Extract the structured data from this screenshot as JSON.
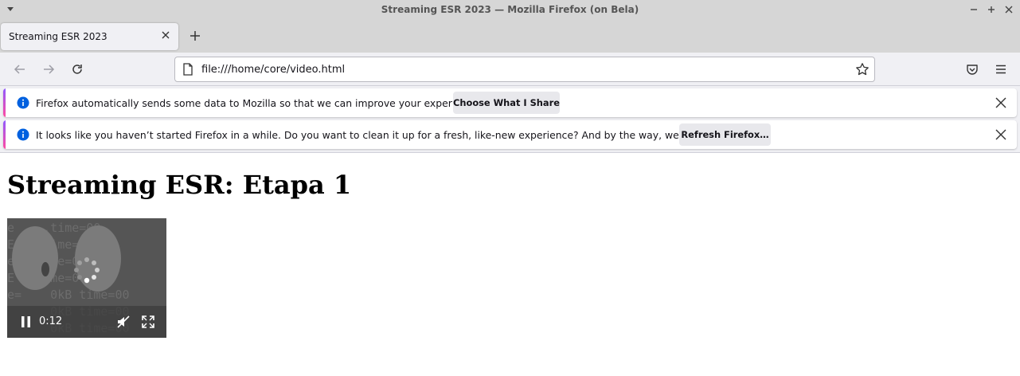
{
  "window": {
    "title": "Streaming ESR 2023 — Mozilla Firefox (on Bela)"
  },
  "tabs": [
    {
      "label": "Streaming ESR 2023"
    }
  ],
  "navbar": {
    "url": "file:///home/core/video.html"
  },
  "notifications": [
    {
      "message": "Firefox automatically sends some data to Mozilla so that we can improve your experience.",
      "button_label": "Choose What I Share"
    },
    {
      "message": "It looks like you haven’t started Firefox in a while. Do you want to clean it up for a fresh, like-new experience? And by the way, welcome back!",
      "button_label": "Refresh Firefox…"
    }
  ],
  "page": {
    "heading": "Streaming ESR: Etapa 1",
    "video": {
      "current_time": "0:12",
      "state": "playing",
      "muted": true
    }
  },
  "colors": {
    "accent": "#0060df",
    "chrome": "#f0f0f4",
    "titlebar": "#d6d6d6"
  },
  "icons": [
    "menu-arrow-icon",
    "minimize-icon",
    "maximize-icon",
    "close-icon",
    "tab-close-icon",
    "plus-icon",
    "back-arrow-icon",
    "forward-arrow-icon",
    "reload-icon",
    "page-icon",
    "star-icon",
    "pocket-icon",
    "hamburger-menu-icon",
    "info-icon",
    "pause-icon",
    "muted-speaker-icon",
    "fullscreen-icon",
    "loading-spinner-icon"
  ]
}
